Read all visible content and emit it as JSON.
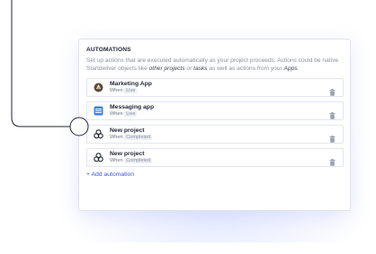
{
  "automations": {
    "title": "AUTOMATIONS",
    "description_parts": [
      "Set up actions that are executed automatically as your project proceeds. Actions could be native Startdeliver objects like ",
      "other projects",
      " or ",
      "tasks",
      " as well as actions from your ",
      "Apps",
      "."
    ],
    "items": [
      {
        "name": "Marketing App",
        "when_label": "When",
        "trigger": "Live",
        "icon": "marketing-app-icon"
      },
      {
        "name": "Messaging app",
        "when_label": "When",
        "trigger": "Live",
        "icon": "messaging-app-icon"
      },
      {
        "name": "New project",
        "when_label": "When",
        "trigger": "Completed",
        "icon": "project-rings-icon"
      },
      {
        "name": "New project",
        "when_label": "When",
        "trigger": "Completed",
        "icon": "project-rings-icon"
      }
    ],
    "add_label": "+ Add automation"
  },
  "colors": {
    "accent": "#3b55d9",
    "connector": "#1f2433"
  }
}
